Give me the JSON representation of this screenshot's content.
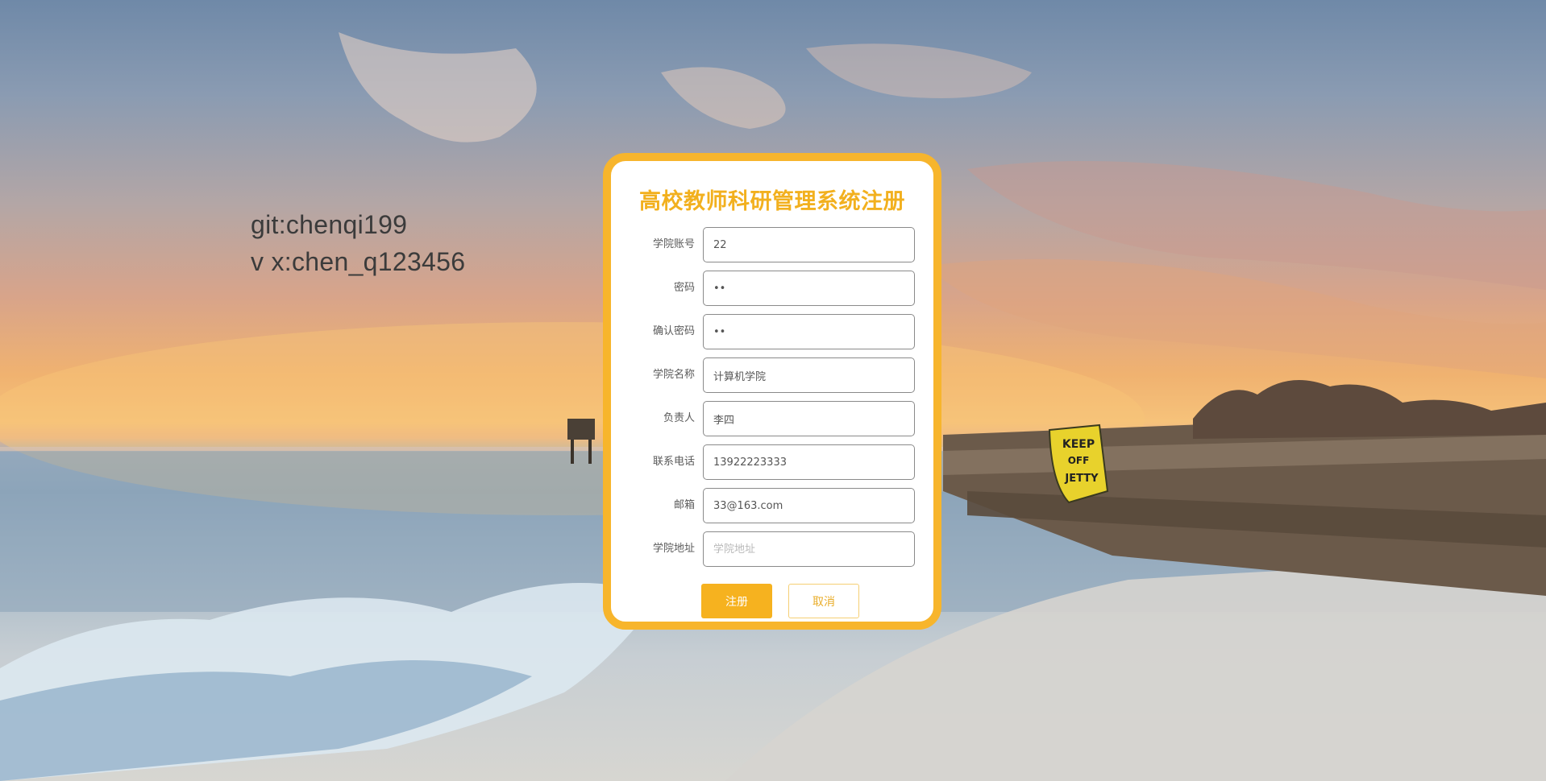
{
  "watermark": {
    "line1": "git:chenqi199",
    "line2": "v x:chen_q123456"
  },
  "form": {
    "title": "高校教师科研管理系统注册",
    "fields": [
      {
        "label": "学院账号",
        "value": "22",
        "placeholder": ""
      },
      {
        "label": "密码",
        "value": "••",
        "placeholder": ""
      },
      {
        "label": "确认密码",
        "value": "••",
        "placeholder": ""
      },
      {
        "label": "学院名称",
        "value": "计算机学院",
        "placeholder": ""
      },
      {
        "label": "负责人",
        "value": "李四",
        "placeholder": ""
      },
      {
        "label": "联系电话",
        "value": "13922223333",
        "placeholder": ""
      },
      {
        "label": "邮箱",
        "value": "33@163.com",
        "placeholder": ""
      },
      {
        "label": "学院地址",
        "value": "",
        "placeholder": "学院地址"
      }
    ],
    "register_label": "注册",
    "cancel_label": "取消"
  },
  "background": {
    "sign_text": [
      "KEEP",
      "OFF",
      "JETTY"
    ]
  },
  "colors": {
    "accent": "#f6b21f",
    "card_border": "#f7b52c"
  }
}
